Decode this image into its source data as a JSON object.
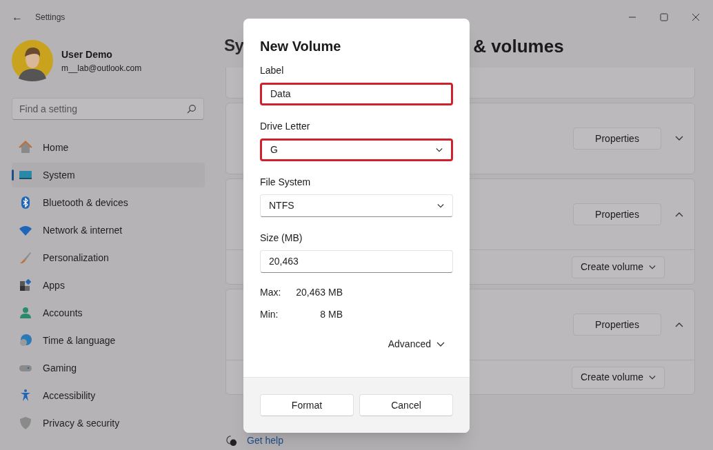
{
  "window": {
    "title": "Settings",
    "back": "←"
  },
  "user": {
    "name": "User Demo",
    "email": "m__lab@outlook.com"
  },
  "search": {
    "placeholder": "Find a setting"
  },
  "nav": [
    {
      "label": "Home",
      "selected": false
    },
    {
      "label": "System",
      "selected": true
    },
    {
      "label": "Bluetooth & devices",
      "selected": false
    },
    {
      "label": "Network & internet",
      "selected": false
    },
    {
      "label": "Personalization",
      "selected": false
    },
    {
      "label": "Apps",
      "selected": false
    },
    {
      "label": "Accounts",
      "selected": false
    },
    {
      "label": "Time & language",
      "selected": false
    },
    {
      "label": "Gaming",
      "selected": false
    },
    {
      "label": "Accessibility",
      "selected": false
    },
    {
      "label": "Privacy & security",
      "selected": false
    }
  ],
  "page_title": {
    "left": "Sy",
    "right": "& volumes"
  },
  "cards": [
    {
      "kind": "stub"
    },
    {
      "kind": "drive",
      "button": "Properties",
      "expanded": false
    },
    {
      "kind": "drive",
      "button": "Properties",
      "expanded": true,
      "action": "Create volume"
    },
    {
      "kind": "drive",
      "button": "Properties",
      "expanded": true,
      "action": "Create volume"
    }
  ],
  "help": "Get help",
  "dialog": {
    "title": "New Volume",
    "fields": [
      {
        "kind": "text",
        "label": "Label",
        "value": "Data",
        "highlighted": true
      },
      {
        "kind": "select",
        "label": "Drive Letter",
        "value": "G",
        "highlighted": true
      },
      {
        "kind": "select",
        "label": "File System",
        "value": "NTFS",
        "highlighted": false
      },
      {
        "kind": "text",
        "label": "Size (MB)",
        "value": "20,463",
        "highlighted": false
      }
    ],
    "limits": [
      {
        "label": "Max:",
        "value": "20,463 MB"
      },
      {
        "label": "Min:",
        "value": "8 MB"
      }
    ],
    "advanced": {
      "label": "Advanced",
      "expanded": false
    },
    "buttons": [
      "Format",
      "Cancel"
    ]
  }
}
